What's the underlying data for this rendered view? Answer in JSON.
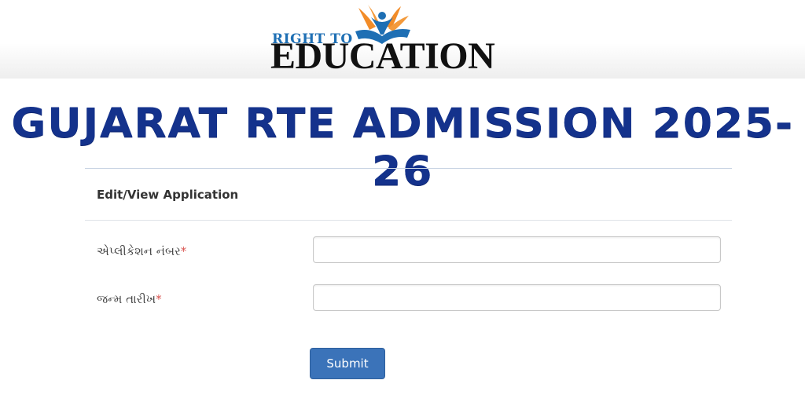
{
  "logo": {
    "top_text": "RIGHT TO",
    "main_text": "EDUCATION"
  },
  "banner": {
    "title": "GUJARAT RTE ADMISSION 2025-26"
  },
  "form": {
    "heading": "Edit/View Application",
    "fields": [
      {
        "label": "એપ્લીકેશન નંબર",
        "required_mark": "*",
        "value": ""
      },
      {
        "label": "જન્મ તારીખ",
        "required_mark": "*",
        "value": ""
      }
    ],
    "submit_label": "Submit"
  },
  "colors": {
    "title": "#14328c",
    "button": "#3b73b9",
    "required": "#d9534f",
    "logo_blue": "#1e6fb4",
    "logo_orange": "#f28c28"
  }
}
